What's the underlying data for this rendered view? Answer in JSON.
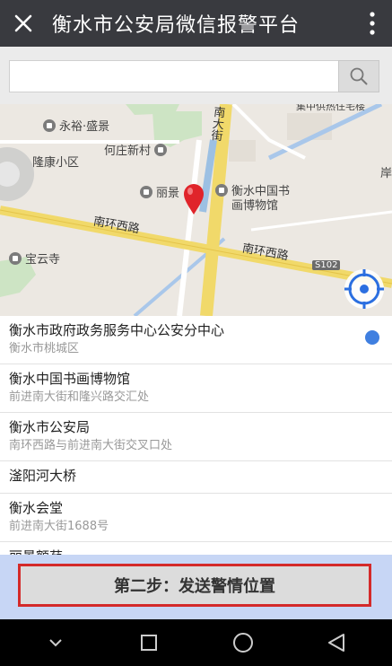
{
  "header": {
    "title": "衡水市公安局微信报警平台",
    "close_icon": "close-icon",
    "more_icon": "more-vertical-icon"
  },
  "search": {
    "value": "",
    "placeholder": "",
    "icon": "search-icon"
  },
  "map": {
    "pois": [
      "永裕·盛景",
      "何庄新村",
      "隆康小区",
      "丽景",
      "衡水中国书",
      "画博物馆",
      "宝云寺",
      "集中供热住宅楼",
      "岸"
    ],
    "roads": [
      "南大街",
      "南环西路",
      "南环西路"
    ],
    "route_badge": "S102",
    "marker_color": "#e0242a",
    "locate_icon": "locate-target-icon"
  },
  "locations": [
    {
      "name": "衡水市政府政务服务中心公安分中心",
      "address": "衡水市桃城区",
      "selected": true
    },
    {
      "name": "衡水中国书画博物馆",
      "address": "前进南大街和隆兴路交汇处"
    },
    {
      "name": "衡水市公安局",
      "address": "南环西路与前进南大街交叉口处"
    },
    {
      "name": "滏阳河大桥",
      "address": ""
    },
    {
      "name": "衡水会堂",
      "address": "前进南大街1688号"
    },
    {
      "name": "丽景额苑",
      "address": ""
    }
  ],
  "action": {
    "label": "第二步：发送警情位置",
    "border_color": "#d42a2a"
  },
  "navbar": {
    "icons": [
      "chevron-down-icon",
      "recent-apps-icon",
      "home-icon",
      "back-icon"
    ]
  }
}
